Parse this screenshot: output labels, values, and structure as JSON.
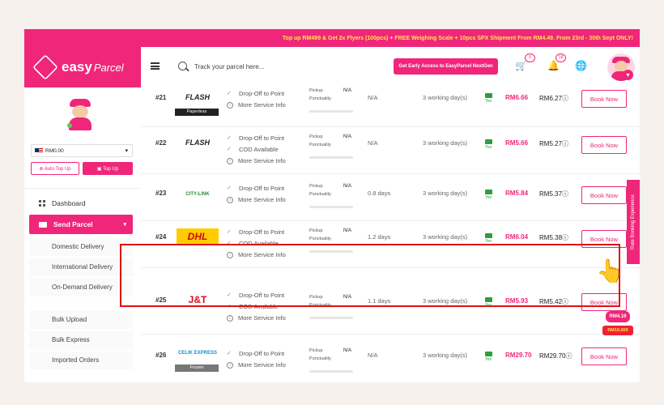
{
  "promo_banner": "Top up RM499 & Get 2x Flyers (100pcs) + FREE Weighing Scale + 10pcs SPX Shipment From RM4.49. From 23rd - 30th Sept ONLY!",
  "brand": {
    "name": "easy",
    "name2": "Parcel"
  },
  "topbar": {
    "search_placeholder": "Track your parcel here...",
    "early_access_label": "Get Early Access to EasyParcel NextGen",
    "cart_count": "0",
    "notif_count": "18"
  },
  "sidebar": {
    "balance": "RM0.00",
    "auto_topup_label": "Auto Top Up",
    "topup_label": "Top Up",
    "dashboard_label": "Dashboard",
    "send_parcel_label": "Send Parcel",
    "sub_items": [
      "Domestic Delivery",
      "International Delivery",
      "On-Demand Delivery",
      "Bulk Upload",
      "Bulk Express",
      "Imported Orders"
    ]
  },
  "labels": {
    "dropoff": "Drop-Off to Point",
    "cod": "COD Available",
    "more_info": "More Service Info",
    "pickup": "Pickup",
    "punctuality": "Punctuality",
    "yes": "Yes",
    "book": "Book Now"
  },
  "couriers": [
    {
      "num": "#21",
      "logo": "FLASH",
      "tag": "Paperless",
      "cod": false,
      "pickup": "N/A",
      "duration": "N/A",
      "days": "3 working day(s)",
      "price": "RM6.66",
      "price2": "RM6.27"
    },
    {
      "num": "#22",
      "logo": "FLASH",
      "tag": "",
      "cod": true,
      "pickup": "N/A",
      "duration": "N/A",
      "days": "3 working day(s)",
      "price": "RM5.66",
      "price2": "RM5.27"
    },
    {
      "num": "#23",
      "logo": "CITY-LINK",
      "tag": "",
      "cod": false,
      "pickup": "N/A",
      "duration": "0.8 days",
      "days": "3 working day(s)",
      "price": "RM5.84",
      "price2": "RM5.37"
    },
    {
      "num": "#24",
      "logo": "DHL",
      "tag": "",
      "cod": true,
      "pickup": "N/A",
      "duration": "1.2 days",
      "days": "3 working day(s)",
      "price": "RM6.04",
      "price2": "RM5.38"
    },
    {
      "num": "#25",
      "logo": "J&T",
      "tag": "",
      "cod": true,
      "pickup": "N/A",
      "duration": "1.1 days",
      "days": "3 working day(s)",
      "price": "RM5.93",
      "price2": "RM5.42"
    },
    {
      "num": "#26",
      "logo": "CELIK EXPRESS",
      "tag": "Frozen",
      "cod": false,
      "pickup": "N/A",
      "duration": "N/A",
      "days": "3 working day(s)",
      "price": "RM29.70",
      "price2": "RM29.70"
    }
  ],
  "side_tab": "Rate Booking Experience",
  "floating_promo": {
    "amount": "RM4.19",
    "sub": "RM10,000"
  }
}
